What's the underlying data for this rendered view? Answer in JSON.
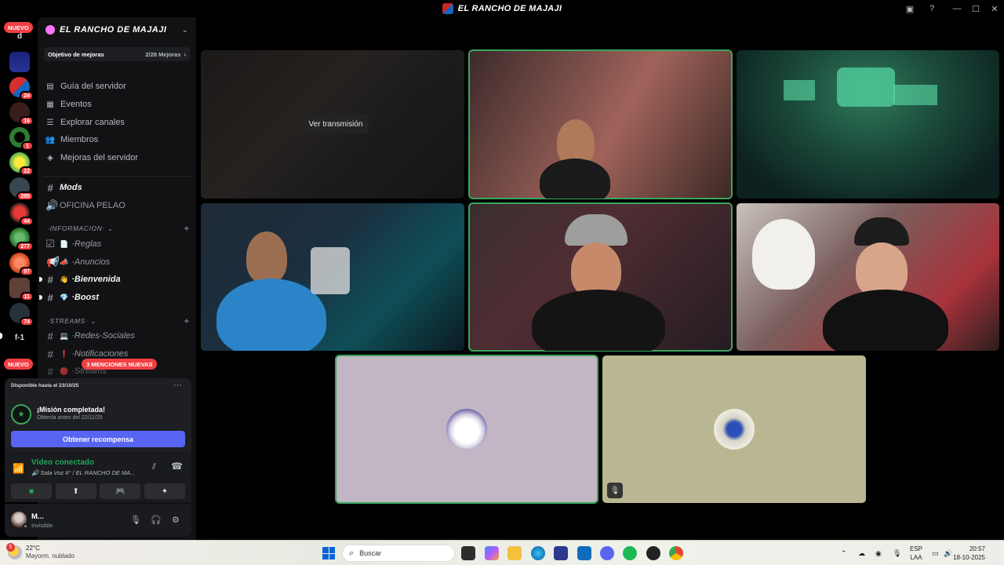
{
  "window": {
    "title": "EL RANCHO DE MAJAJI"
  },
  "rail": {
    "top_letter": "d",
    "nuevo_top": "NUEVO",
    "nuevo_bottom": "NUEVO",
    "f1_label": "f-1",
    "badges": [
      "24",
      "16",
      "1",
      "22",
      "285",
      "44",
      "277",
      "97",
      "11",
      "74"
    ]
  },
  "server": {
    "name": "EL RANCHO DE MAJAJI",
    "boost_label": "Objetivo de mejoras",
    "boost_progress": "2/28 Mejoras"
  },
  "nav": [
    {
      "label": "Guía del servidor",
      "icon": "guide-icon"
    },
    {
      "label": "Eventos",
      "icon": "calendar-icon"
    },
    {
      "label": "Explorar canales",
      "icon": "browse-channels-icon"
    },
    {
      "label": "Miembros",
      "icon": "members-icon"
    },
    {
      "label": "Mejoras del servidor",
      "icon": "boost-icon"
    }
  ],
  "channels": {
    "mods": "Mods",
    "oficina": "OFICINA PELAO",
    "cat_informacion": "INFORMACION",
    "reglas": "Reglas",
    "anuncios": "Anuncios",
    "bienvenida": "Bienvenida",
    "boost": "Boost",
    "cat_streams": "STREAMS",
    "redes": "Redes-Sociales",
    "notificaciones": "Notificaciones",
    "streams": "Streams",
    "mentions": "3 MENCIONES NUEVAS"
  },
  "quest": {
    "available_until": "Disponible hasta el 23/10/25",
    "title": "¡Misión completada!",
    "subtitle": "Obtenla antes del 22/11/25",
    "claim_button": "Obtener recompensa"
  },
  "voice": {
    "status": "Vídeo conectado",
    "channel": "Sala Voz #° / EL RANCHO DE MA..."
  },
  "user": {
    "name": "M...",
    "status": "Invisible"
  },
  "stage": {
    "watch_stream": "Ver transmisión"
  },
  "taskbar": {
    "weather_badge": "5",
    "temperature": "22°C",
    "weather_desc": "Mayorm. nublado",
    "search_placeholder": "Buscar",
    "lang_top": "ESP",
    "lang_bottom": "LAA",
    "time": "20:57",
    "date": "18-10-2025"
  },
  "colors": {
    "accent": "#5865f2",
    "speaking": "#3ba55c",
    "danger": "#f23f43",
    "tile_avatar_1": "#c2b5c4",
    "tile_avatar_2": "#b8b791"
  }
}
